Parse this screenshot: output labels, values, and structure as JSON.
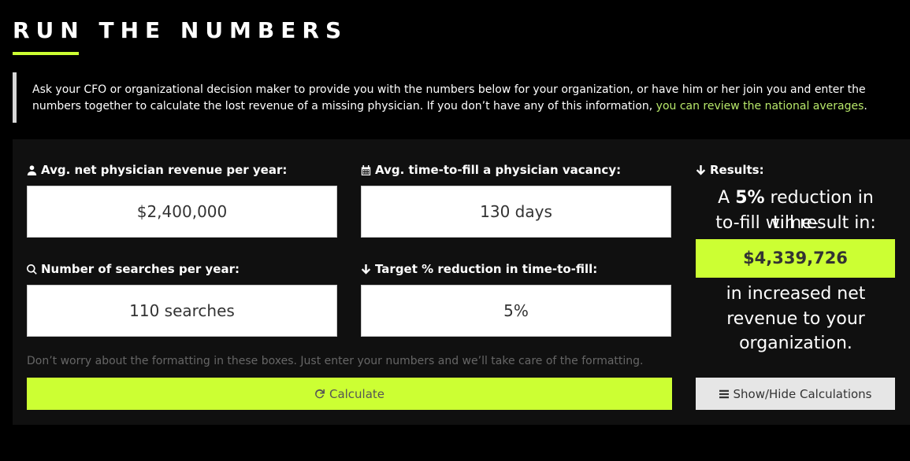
{
  "header": {
    "title": "RUN THE NUMBERS"
  },
  "intro": {
    "text": "Ask your CFO or organizational decision maker to provide you with the numbers below for your organization, or have him or her join you and enter the numbers together to calculate the lost revenue of a missing physician. If you don’t have any of this information, ",
    "link_text": "you can review the national averages",
    "tail": "."
  },
  "fields": {
    "revenue": {
      "label": "Avg. net physician revenue per year:",
      "value": "$2,400,000",
      "icon": "user-md-icon"
    },
    "time_to_fill": {
      "label": "Avg. time-to-fill a physician vacancy:",
      "value": "130 days",
      "icon": "calendar-icon"
    },
    "searches": {
      "label": "Number of searches per year:",
      "value": "110 searches",
      "icon": "search-icon"
    },
    "reduction": {
      "label": "Target % reduction in time-to-fill:",
      "value": "5%",
      "icon": "arrow-down-icon"
    }
  },
  "hint": "Don’t worry about the formatting in these boxes. Just enter your numbers and we’ll take care of the formatting.",
  "calculate_label": "Calculate",
  "results": {
    "label": "Results:",
    "line1_prefix": "A ",
    "line1_percent": "5%",
    "line1_suffix": " reduction in time-",
    "line2": "to-fill will result in:",
    "amount": "$4,339,726",
    "line3": "in increased net",
    "line4": "revenue to your",
    "line5": "organization."
  },
  "toggle_label": "Show/Hide Calculations",
  "colors": {
    "accent": "#ccff33",
    "link": "#b8e86a",
    "background": "#000000",
    "panel": "#101010"
  }
}
